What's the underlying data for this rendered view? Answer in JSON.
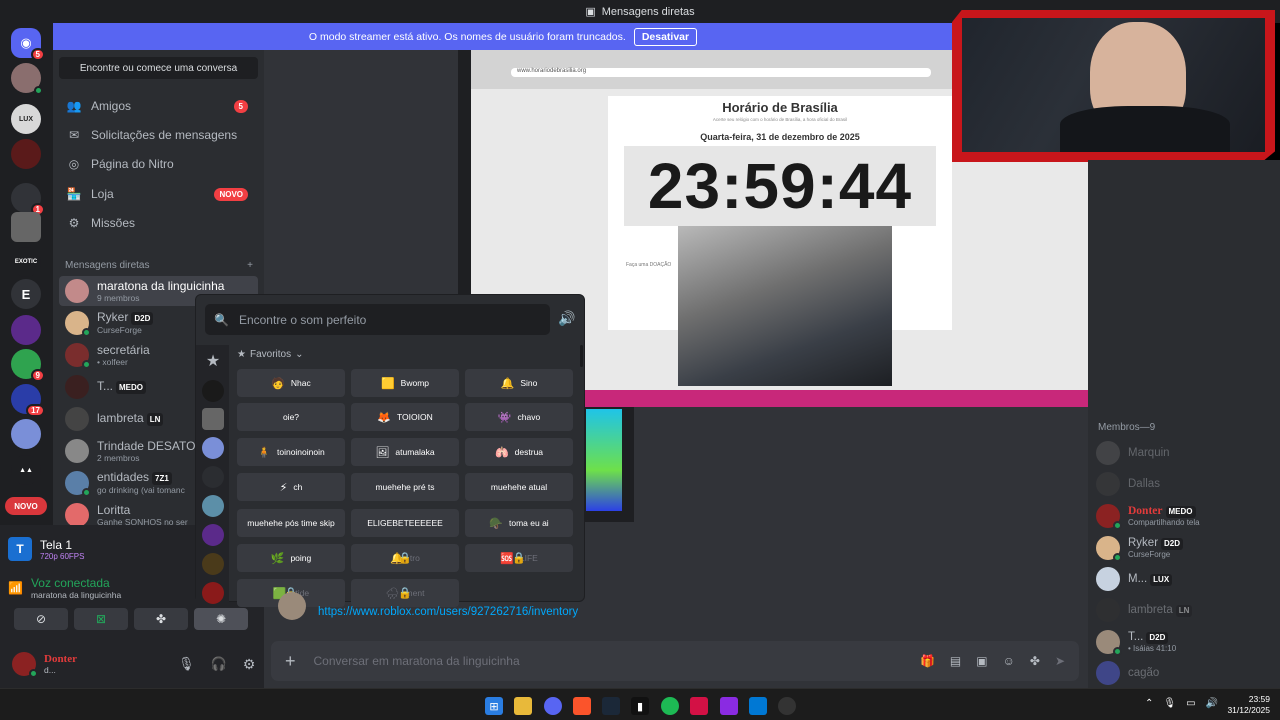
{
  "titlebar": {
    "title": "Mensagens diretas"
  },
  "banner": {
    "text": "O modo streamer está ativo. Os nomes de usuário foram truncados.",
    "button": "Desativar"
  },
  "guilds": {
    "home_badge": "5",
    "badge_1": "1",
    "badge_2": "9",
    "badge_3": "17",
    "letter_server": "E",
    "new_label": "NOVO",
    "exotic_label": "EXOTIC"
  },
  "sidebar": {
    "search_label": "Encontre ou comece uma conversa",
    "nav": [
      {
        "label": "Amigos",
        "badge": "5"
      },
      {
        "label": "Solicitações de mensagens"
      },
      {
        "label": "Página do Nitro"
      },
      {
        "label": "Loja",
        "badge": "NOVO"
      },
      {
        "label": "Missões"
      }
    ],
    "dm_header": "Mensagens diretas",
    "dms": [
      {
        "name": "maratona da linguicinha",
        "sub": "9 membros"
      },
      {
        "name": "Ryker",
        "tag": "D2D",
        "sub": "CurseForge"
      },
      {
        "name": "secretária",
        "sub": "• xolfeer"
      },
      {
        "name": "T...",
        "tag": "MEDO",
        "sub": ""
      },
      {
        "name": "lambreta",
        "tag": "LN",
        "sub": ""
      },
      {
        "name": "Trindade DESATOS",
        "sub": "2 membros"
      },
      {
        "name": "entidades",
        "tag": "7Z1",
        "sub": "go drinking (vai tomanc"
      },
      {
        "name": "Loritta",
        "sub": "Ganhe SONHOS no ser"
      }
    ]
  },
  "bottom_panel": {
    "share_title": "Tela 1",
    "share_quality": "720p 60FPS",
    "voice_status": "Voz conectada",
    "voice_channel": "maratona da linguicinha",
    "user_name": "Donter",
    "user_status": "d..."
  },
  "stream": {
    "site_title": "Horário de Brasília",
    "site_subtitle": "Acerte seu relógio com o horário de Brasília, a hora oficial do Brasil",
    "date": "Quarta-feira, 31 de dezembro de 2025",
    "clock": "23:59:44",
    "donation_note": "Faça uma DOAÇÃO",
    "url": "www.horariodebrasilia.org"
  },
  "soundboard": {
    "search_placeholder": "Encontre o som perfeito",
    "favorites_label": "Favoritos",
    "sounds": [
      {
        "label": "Nhac",
        "emoji": "🧑"
      },
      {
        "label": "Bwomp",
        "emoji": "🟨"
      },
      {
        "label": "Sino",
        "emoji": "🔔"
      },
      {
        "label": "oie?",
        "emoji": ""
      },
      {
        "label": "TOIOION",
        "emoji": "🦊"
      },
      {
        "label": "chavo",
        "emoji": "👾"
      },
      {
        "label": "toinoinoinoin",
        "emoji": "🧍"
      },
      {
        "label": "atumalaka",
        "emoji": "🖼"
      },
      {
        "label": "destrua",
        "emoji": "🫁"
      },
      {
        "label": "ch",
        "emoji": "⚡"
      },
      {
        "label": "muehehe pré ts",
        "emoji": ""
      },
      {
        "label": "muehehe atual",
        "emoji": ""
      },
      {
        "label": "muehehe pós time skip",
        "emoji": ""
      },
      {
        "label": "ELIGEBETEEEEEE",
        "emoji": ""
      },
      {
        "label": "toma eu ai",
        "emoji": "🪖"
      },
      {
        "label": "poing",
        "emoji": "🌿"
      },
      {
        "label": "tro",
        "emoji": "🔔"
      },
      {
        "label": "LIFE",
        "emoji": "🆘"
      },
      {
        "label": "rtide",
        "emoji": "🟩"
      },
      {
        "label": "ment",
        "emoji": "🌧"
      }
    ]
  },
  "chat": {
    "link": "https://www.roblox.com/users/927262716/inventory",
    "composer_placeholder": "Conversar em maratona da linguicinha"
  },
  "members": {
    "header": "Membros—9",
    "list": [
      {
        "name": "Marquin",
        "sub": ""
      },
      {
        "name": "Dallas",
        "sub": ""
      },
      {
        "name": "Donter",
        "tag": "MEDO",
        "sub": "Compartilhando tela"
      },
      {
        "name": "Ryker",
        "tag": "D2D",
        "sub": "CurseForge"
      },
      {
        "name": "M...",
        "tag": "LUX",
        "sub": ""
      },
      {
        "name": "lambreta",
        "tag": "LN",
        "sub": ""
      },
      {
        "name": "T...",
        "tag": "D2D",
        "sub": "• Isáias 41:10"
      },
      {
        "name": "cagão",
        "sub": ""
      }
    ]
  },
  "taskbar": {
    "time": "23:59",
    "date": "31/12/2025"
  }
}
